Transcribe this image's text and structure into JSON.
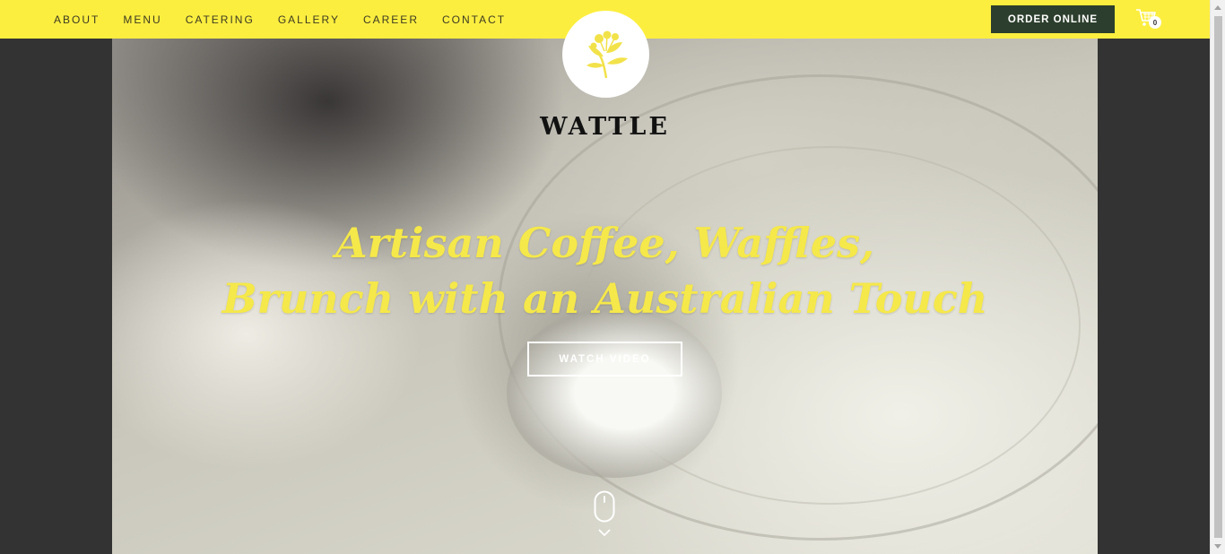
{
  "nav": {
    "items": [
      {
        "label": "ABOUT"
      },
      {
        "label": "MENU"
      },
      {
        "label": "CATERING"
      },
      {
        "label": "GALLERY"
      },
      {
        "label": "CAREER"
      },
      {
        "label": "CONTACT"
      }
    ]
  },
  "header": {
    "order_label": "ORDER ONLINE",
    "cart_count": "0",
    "cart_icon": "shopping-cart-icon"
  },
  "brand": {
    "logo_icon": "wattle-flower-logo",
    "name": "WATTLE"
  },
  "hero": {
    "headline_line1": "Artisan Coffee, Waffles,",
    "headline_line2": "Brunch with an Australian Touch",
    "watch_label": "WATCH VIDEO",
    "scroll_icon": "mouse-scroll-icon"
  },
  "colors": {
    "topbar": "#fcee3f",
    "accent_text": "#f5e84a",
    "order_button": "#2c3e2d",
    "page_background": "#333333"
  }
}
